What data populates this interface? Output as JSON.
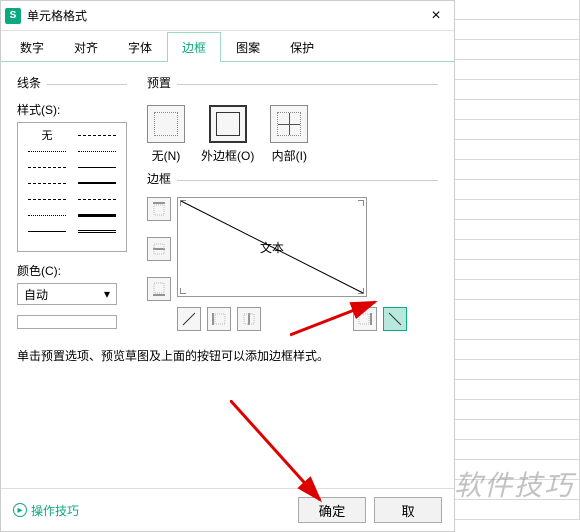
{
  "dialog": {
    "title": "单元格格式",
    "close": "×"
  },
  "tabs": [
    {
      "label": "数字"
    },
    {
      "label": "对齐"
    },
    {
      "label": "字体"
    },
    {
      "label": "边框"
    },
    {
      "label": "图案"
    },
    {
      "label": "保护"
    }
  ],
  "line": {
    "sectionTitle": "线条",
    "styleLabel": "样式(S):",
    "noneLabel": "无",
    "colorLabel": "颜色(C):",
    "colorValue": "自动"
  },
  "presets": {
    "sectionTitle": "预置",
    "none": "无(N)",
    "outline": "外边框(O)",
    "inside": "内部(I)"
  },
  "border": {
    "sectionTitle": "边框",
    "previewText": "文本"
  },
  "hint": "单击预置选项、预览草图及上面的按钮可以添加边框样式。",
  "footer": {
    "tips": "操作技巧",
    "ok": "确定",
    "cancel": "取"
  },
  "watermark": "软件技巧"
}
